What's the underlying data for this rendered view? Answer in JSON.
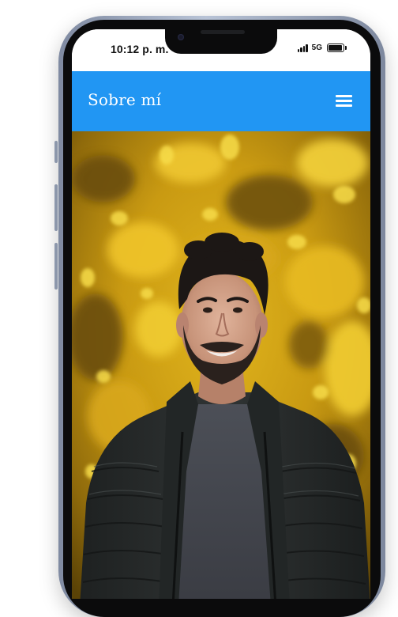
{
  "status_bar": {
    "time": "10:12 p. m.",
    "network": "5G",
    "battery_level": 0.85
  },
  "header": {
    "title": "Sobre mí",
    "menu_icon": "hamburger-menu-icon"
  },
  "photo": {
    "description_icon": "profile-photo"
  },
  "colors": {
    "header_background": "#2196f3",
    "header_text": "#ffffff"
  }
}
